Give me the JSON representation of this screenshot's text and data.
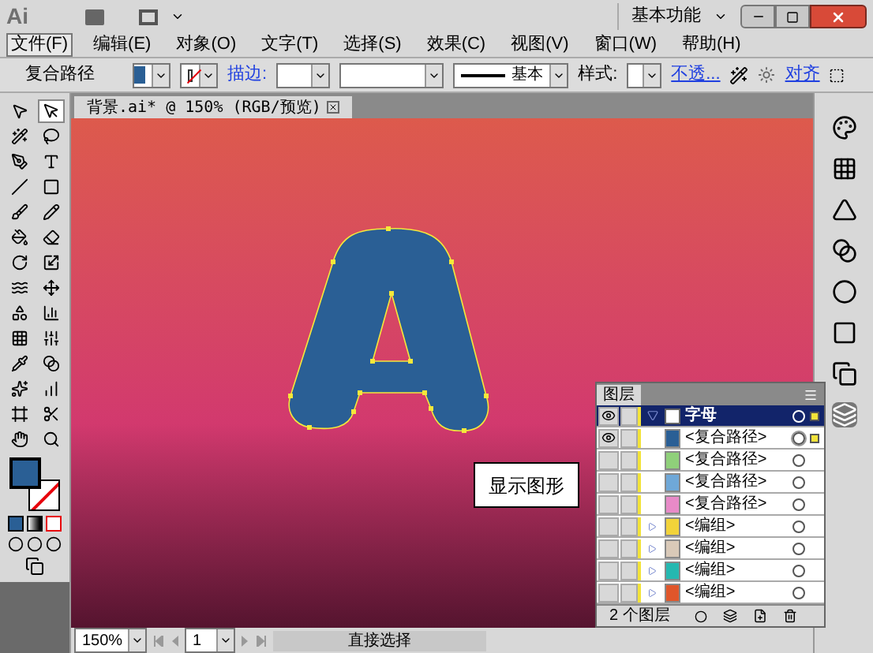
{
  "app": {
    "logo": "Ai",
    "workspace": "基本功能"
  },
  "menu": [
    {
      "label": "文件(F)",
      "selected": true
    },
    {
      "label": "编辑(E)",
      "selected": false
    },
    {
      "label": "对象(O)",
      "selected": false
    },
    {
      "label": "文字(T)",
      "selected": false
    },
    {
      "label": "选择(S)",
      "selected": false
    },
    {
      "label": "效果(C)",
      "selected": false
    },
    {
      "label": "视图(V)",
      "selected": false
    },
    {
      "label": "窗口(W)",
      "selected": false
    },
    {
      "label": "帮助(H)",
      "selected": false
    }
  ],
  "control_bar": {
    "object_type": "复合路径",
    "stroke_label": "描边:",
    "stroke_profile": "基本",
    "style_label": "样式:",
    "opacity_link": "不透...",
    "align_link": "对齐"
  },
  "document_tab": {
    "title": "背景.ai* @ 150% (RGB/预览)"
  },
  "tools": [
    {
      "kind": "select",
      "selected": false
    },
    {
      "kind": "direct",
      "selected": true
    },
    {
      "kind": "wand",
      "selected": false
    },
    {
      "kind": "lasso",
      "selected": false
    },
    {
      "kind": "pen",
      "selected": false
    },
    {
      "kind": "type",
      "selected": false
    },
    {
      "kind": "line",
      "selected": false
    },
    {
      "kind": "rect",
      "selected": false
    },
    {
      "kind": "brush",
      "selected": false
    },
    {
      "kind": "pencil",
      "selected": false
    },
    {
      "kind": "blob",
      "selected": false
    },
    {
      "kind": "eraser",
      "selected": false
    },
    {
      "kind": "rotate",
      "selected": false
    },
    {
      "kind": "scale",
      "selected": false
    },
    {
      "kind": "warp",
      "selected": false
    },
    {
      "kind": "transform",
      "selected": false
    },
    {
      "kind": "shapebuilder",
      "selected": false
    },
    {
      "kind": "graph",
      "selected": false
    },
    {
      "kind": "mesh",
      "selected": false
    },
    {
      "kind": "gradient",
      "selected": false
    },
    {
      "kind": "eyedropper",
      "selected": false
    },
    {
      "kind": "blend",
      "selected": false
    },
    {
      "kind": "symbol",
      "selected": false
    },
    {
      "kind": "column",
      "selected": false
    },
    {
      "kind": "artboard",
      "selected": false
    },
    {
      "kind": "slice",
      "selected": false
    },
    {
      "kind": "hand",
      "selected": false
    },
    {
      "kind": "zoom",
      "selected": false
    }
  ],
  "callout": "显示图形",
  "layers_panel": {
    "title": "图层",
    "layers": [
      {
        "name": "字母",
        "visible": true,
        "expanded": true,
        "selected": true,
        "children": [
          {
            "name": "<复合路径>",
            "visible": true,
            "selected": true,
            "color": "#2a5f95",
            "group": false
          },
          {
            "name": "<复合路径>",
            "visible": false,
            "selected": false,
            "color": "#8fd07a",
            "group": false
          },
          {
            "name": "<复合路径>",
            "visible": false,
            "selected": false,
            "color": "#6fa8d8",
            "group": false
          },
          {
            "name": "<复合路径>",
            "visible": false,
            "selected": false,
            "color": "#e88ac8",
            "group": false
          },
          {
            "name": "<编组>",
            "visible": false,
            "selected": false,
            "color": "#f2d33a",
            "group": true
          },
          {
            "name": "<编组>",
            "visible": false,
            "selected": false,
            "color": "#d9c9b8",
            "group": true
          },
          {
            "name": "<编组>",
            "visible": false,
            "selected": false,
            "color": "#25b8b0",
            "group": true
          },
          {
            "name": "<编组>",
            "visible": false,
            "selected": false,
            "color": "#e0562a",
            "group": true
          }
        ]
      }
    ],
    "footer": "2 个图层"
  },
  "status_bar": {
    "zoom": "150%",
    "page": "1",
    "tool": "直接选择"
  }
}
